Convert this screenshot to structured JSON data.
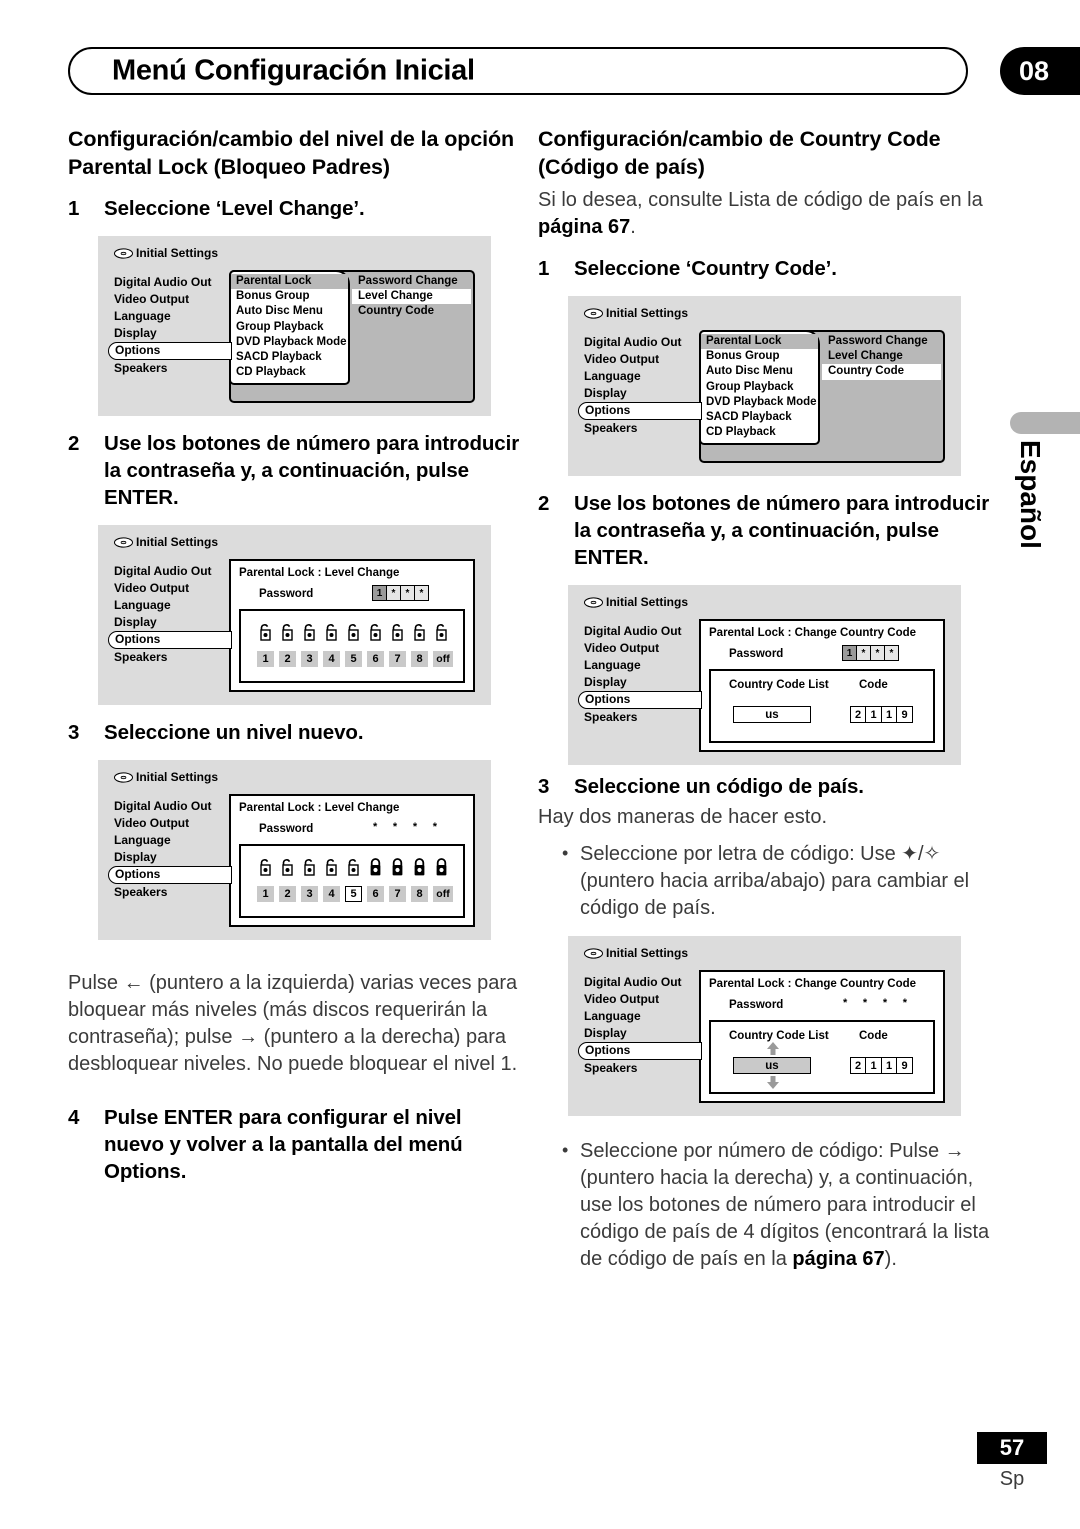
{
  "header": {
    "title": "Menú Configuración Inicial",
    "chapter": "08"
  },
  "side_tab": {
    "language": "Español"
  },
  "footer": {
    "page_number": "57",
    "language_code": "Sp"
  },
  "left_column": {
    "section_title": "Configuración/cambio del nivel de la opción Parental Lock (Bloqueo Padres)",
    "step1": {
      "num": "1",
      "text": "Seleccione ‘Level Change’."
    },
    "step2": {
      "num": "2",
      "text": "Use los botones de número para introducir la contraseña y, a continuación, pulse ENTER."
    },
    "step3": {
      "num": "3",
      "text": "Seleccione un nivel nuevo."
    },
    "note": "Pulse ← (puntero a la izquierda) varias veces para bloquear más niveles (más discos requerirán la contraseña); pulse → (puntero a la derecha) para desbloquear niveles. No puede bloquear el nivel 1.",
    "step4": {
      "num": "4",
      "text": "Pulse ENTER para configurar el nivel nuevo y volver a la pantalla del menú Options."
    }
  },
  "right_column": {
    "section_title": "Configuración/cambio de Country Code (Código de país)",
    "intro": {
      "pre": "Si lo desea, consulte Lista de código de país en la ",
      "bold": "página 67",
      "post": "."
    },
    "step1": {
      "num": "1",
      "text": "Seleccione ‘Country Code’."
    },
    "step2": {
      "num": "2",
      "text": "Use los botones de número para introducir la contraseña y, a continuación, pulse ENTER."
    },
    "step3": {
      "num": "3",
      "text": "Seleccione un código de país."
    },
    "step3_note": "Hay dos maneras de hacer esto.",
    "bullet1": "Seleccione por letra de código: Use ✦/✧ (puntero hacia arriba/abajo) para cambiar el código de país.",
    "bullet2": {
      "pre": "Seleccione por número de código: Pulse → (puntero hacia la derecha) y, a continuación, use los botones de número para introducir el código de país de 4 dígitos (encontrará la lista de código de país en la ",
      "bold": "página 67",
      "post": ")."
    }
  },
  "osd": {
    "title": "Initial Settings",
    "sidebar_items": [
      "Digital Audio Out",
      "Video Output",
      "Language",
      "Display",
      "Options",
      "Speakers"
    ],
    "sidebar_selected": "Options",
    "menu_col1": [
      "Parental Lock",
      "Bonus Group",
      "Auto Disc Menu",
      "Group Playback",
      "DVD Playback Mode",
      "SACD Playback",
      "CD Playback"
    ],
    "menu_col1_highlight": "Parental Lock",
    "menu_col2": [
      "Password Change",
      "Level Change",
      "Country Code"
    ],
    "screen1_selected": "Level Change",
    "screen4_selected": "Country Code",
    "detail_title_level": "Parental Lock : Level Change",
    "detail_title_country": "Parental Lock : Change Country Code",
    "password_label": "Password",
    "password_entered": [
      "1",
      "*",
      "*",
      "*"
    ],
    "password_masked": [
      "*",
      "*",
      "*",
      "*"
    ],
    "levels": [
      "1",
      "2",
      "3",
      "4",
      "5",
      "6",
      "7",
      "8",
      "off"
    ],
    "locks_all_open": [
      "open",
      "open",
      "open",
      "open",
      "open",
      "open",
      "open",
      "open",
      "open"
    ],
    "locks_level5": [
      "open",
      "open",
      "open",
      "open",
      "open",
      "closed",
      "closed",
      "closed",
      "closed"
    ],
    "level_selected": "5",
    "country_code_list_label": "Country Code List",
    "country_code_label": "Code",
    "country_code_value": "us",
    "country_code_digits": [
      "2",
      "1",
      "1",
      "9"
    ]
  }
}
